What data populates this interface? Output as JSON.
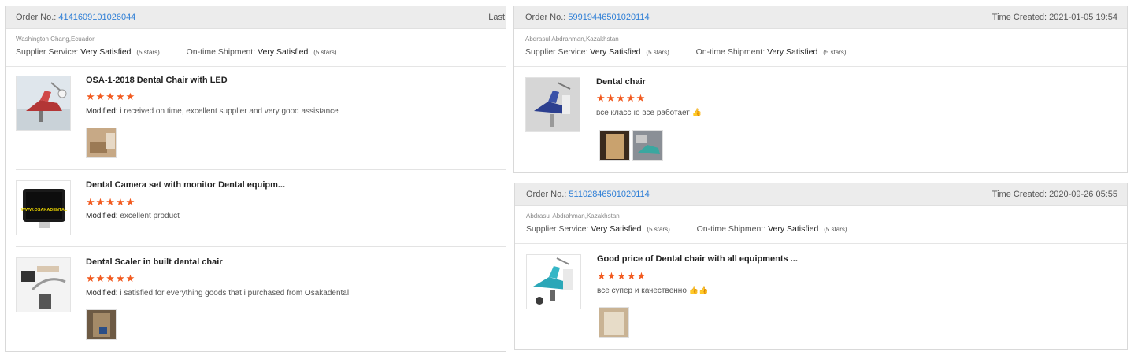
{
  "orders": [
    {
      "order_label": "Order No.:",
      "order_no": "4141609101026044",
      "time_created": "Last",
      "buyer": "Washington Chang,Ecuador",
      "supplier_service_label": "Supplier Service:",
      "supplier_service_value": "Very Satisfied",
      "supplier_service_stars": "(5 stars)",
      "shipment_label": "On-time Shipment:",
      "shipment_value": "Very Satisfied",
      "shipment_stars": "(5 stars)",
      "items": [
        {
          "title": "OSA-1-2018 Dental Chair with LED",
          "rating": "★★★★★",
          "modified_label": "Modified:",
          "review": "i received on time, excellent supplier and very good assistance"
        },
        {
          "title": "Dental Camera set with monitor Dental equipm...",
          "rating": "★★★★★",
          "modified_label": "Modified:",
          "review": "excellent product",
          "image_text": "WWW.OSAKADENTAL"
        },
        {
          "title": "Dental Scaler in built dental chair",
          "rating": "★★★★★",
          "modified_label": "Modified:",
          "review": "i satisfied for everything goods that i purchased from Osakadental"
        }
      ]
    },
    {
      "order_label": "Order No.:",
      "order_no": "59919446501020114",
      "time_created": "Time Created: 2021-01-05 19:54",
      "buyer": "Abdrasul Abdrahman,Kazakhstan",
      "supplier_service_label": "Supplier Service:",
      "supplier_service_value": "Very Satisfied",
      "supplier_service_stars": "(5 stars)",
      "shipment_label": "On-time Shipment:",
      "shipment_value": "Very Satisfied",
      "shipment_stars": "(5 stars)",
      "items": [
        {
          "title": "Dental chair",
          "rating": "★★★★★",
          "review": "все классно все работает 👍"
        }
      ]
    },
    {
      "order_label": "Order No.:",
      "order_no": "51102846501020114",
      "time_created": "Time Created: 2020-09-26 05:55",
      "buyer": "Abdrasul Abdrahman,Kazakhstan",
      "supplier_service_label": "Supplier Service:",
      "supplier_service_value": "Very Satisfied",
      "supplier_service_stars": "(5 stars)",
      "shipment_label": "On-time Shipment:",
      "shipment_value": "Very Satisfied",
      "shipment_stars": "(5 stars)",
      "items": [
        {
          "title": "Good price of Dental chair with all equipments ...",
          "rating": "★★★★★",
          "review": "все супер и качественно 👍👍"
        }
      ]
    }
  ],
  "colors": {
    "link": "#2f7fd6",
    "star": "#f25a1f",
    "header_bg": "#ececec"
  }
}
